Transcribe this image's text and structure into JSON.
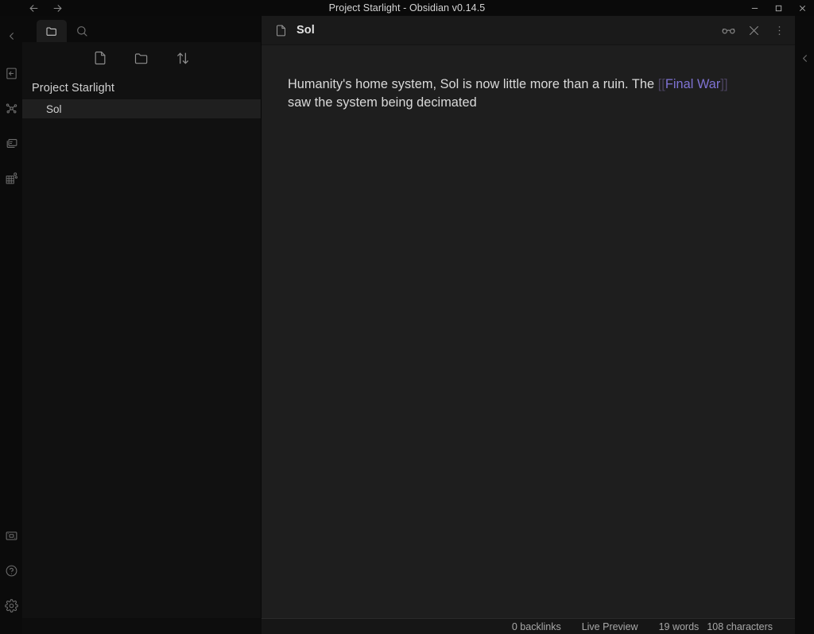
{
  "window": {
    "title": "Project Starlight - Obsidian v0.14.5",
    "back_icon": "arrow-left-icon",
    "forward_icon": "arrow-right-icon",
    "minimize_icon": "minimize-icon",
    "maximize_icon": "maximize-icon",
    "close_icon": "close-icon"
  },
  "left_ribbon": {
    "collapse_icon": "chevron-left-icon",
    "items": [
      {
        "name": "open-note-icon",
        "label": "Open another note"
      },
      {
        "name": "graph-view-icon",
        "label": "Open graph view"
      },
      {
        "name": "canvas-icon",
        "label": "Open canvas"
      },
      {
        "name": "calendar-icon",
        "label": "Open calendar"
      }
    ],
    "bottom_items": [
      {
        "name": "vault-switcher-icon",
        "label": "Open another vault"
      },
      {
        "name": "help-icon",
        "label": "Help"
      },
      {
        "name": "settings-gear-icon",
        "label": "Settings"
      }
    ]
  },
  "right_ribbon": {
    "collapse_icon": "chevron-left-icon"
  },
  "sidebar": {
    "tabs": [
      {
        "name": "tab-file-explorer",
        "icon": "folder-icon",
        "active": true
      },
      {
        "name": "tab-search",
        "icon": "search-icon",
        "active": false
      }
    ],
    "toolbar": [
      {
        "name": "new-note-button",
        "icon": "new-note-icon",
        "label": "New note"
      },
      {
        "name": "new-folder-button",
        "icon": "new-folder-icon",
        "label": "New folder"
      },
      {
        "name": "sort-button",
        "icon": "sort-icon",
        "label": "Change sort order"
      }
    ],
    "vault_name": "Project Starlight",
    "files": [
      {
        "name": "Sol",
        "selected": true
      }
    ]
  },
  "editor": {
    "tab": {
      "icon": "document-icon",
      "title": "Sol"
    },
    "actions": [
      {
        "name": "reading-view-button",
        "icon": "glasses-icon",
        "label": "Current view: editing"
      },
      {
        "name": "close-tab-button",
        "icon": "close-icon",
        "label": "Close"
      },
      {
        "name": "more-options-button",
        "icon": "vertical-dots-icon",
        "label": "More options"
      }
    ],
    "content": {
      "text_before": "Humanity's home system, Sol is now little more than a ruin. The ",
      "link_open": "[[",
      "link_text": "Final War",
      "link_close": "]]",
      "text_after": " saw the system being decimated"
    }
  },
  "statusbar": {
    "backlinks": "0 backlinks",
    "mode": "Live Preview",
    "words": "19 words",
    "characters": "108 characters"
  },
  "colors": {
    "link_text": "#7f73d4",
    "link_bracket": "#4b4360",
    "editor_bg": "#1e1e1e",
    "sidebar_bg": "#111111",
    "ribbon_bg": "#0b0b0b",
    "selected_row": "#1f1f1f"
  }
}
